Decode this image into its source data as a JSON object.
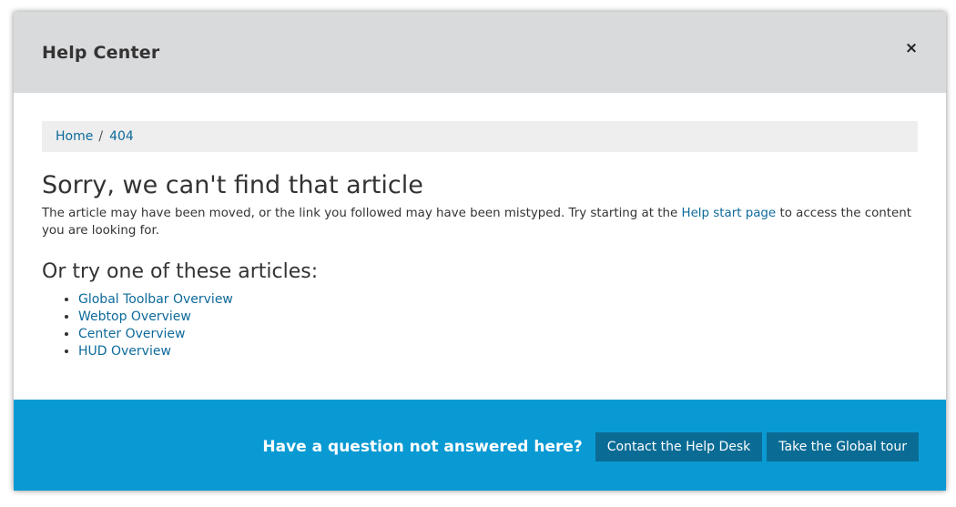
{
  "header": {
    "title": "Help Center",
    "close_label": "×"
  },
  "breadcrumb": {
    "items": [
      {
        "label": "Home"
      },
      {
        "label": "404"
      }
    ],
    "separator": "/"
  },
  "main": {
    "heading": "Sorry, we can't find that article",
    "description_before": "The article may have been moved, or the link you followed may have been mistyped. Try starting at the ",
    "description_link": "Help start page",
    "description_after": " to access the content you are looking for.",
    "suggest_heading": "Or try one of these articles:",
    "articles": [
      {
        "label": "Global Toolbar Overview"
      },
      {
        "label": "Webtop Overview"
      },
      {
        "label": "Center Overview"
      },
      {
        "label": "HUD Overview"
      }
    ]
  },
  "footer": {
    "question": "Have a question not answered here?",
    "contact_label": "Contact the Help Desk",
    "tour_label": "Take the Global tour"
  },
  "colors": {
    "header_bg": "#d9dadc",
    "link": "#0e6a9b",
    "footer_bg": "#0a9ad3",
    "button_bg": "#0a6c95"
  }
}
